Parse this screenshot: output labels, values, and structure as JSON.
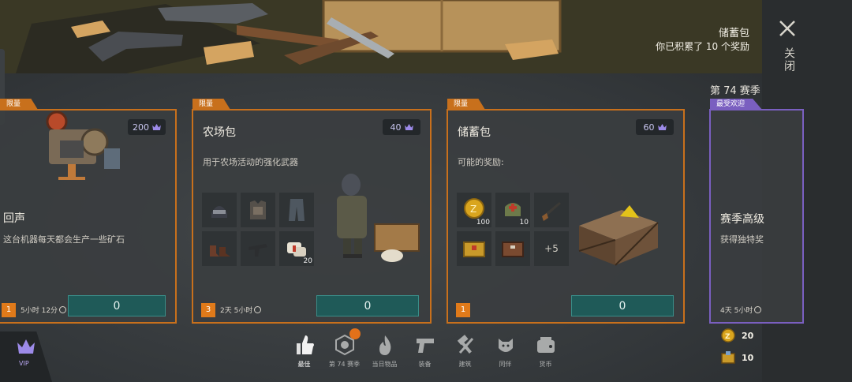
{
  "banner": {
    "title": "储蓄包",
    "subtitle": "你已积累了 10 个奖励"
  },
  "close_label": "关闭",
  "season_heading": "第 74 赛季",
  "cards": [
    {
      "tag": "限量",
      "title": "回声",
      "desc": "这台机器每天都会生产一些矿石",
      "price": "200",
      "qty": "1",
      "timer": "5小时 12分",
      "button": "0"
    },
    {
      "tag": "限量",
      "title": "农场包",
      "desc": "用于农场活动的强化武器",
      "price": "40",
      "qty": "3",
      "timer": "2天 5小时",
      "button": "0",
      "items": [
        {
          "icon": "helmet-icon",
          "count": ""
        },
        {
          "icon": "armor-vest-icon",
          "count": ""
        },
        {
          "icon": "pants-icon",
          "count": ""
        },
        {
          "icon": "boots-icon",
          "count": ""
        },
        {
          "icon": "smg-icon",
          "count": ""
        },
        {
          "icon": "bandage-icon",
          "count": "20"
        }
      ]
    },
    {
      "tag": "限量",
      "title": "储蓄包",
      "desc": "可能的奖励:",
      "price": "60",
      "qty": "1",
      "timer": "",
      "button": "0",
      "items": [
        {
          "icon": "coin-icon",
          "count": "100"
        },
        {
          "icon": "medkit-bag-icon",
          "count": "10"
        },
        {
          "icon": "shotgun-icon",
          "count": ""
        },
        {
          "icon": "yellow-crate-icon",
          "count": ""
        },
        {
          "icon": "brown-crate-icon",
          "count": ""
        }
      ],
      "more": "+5"
    },
    {
      "tag": "最受欢迎",
      "title": "赛季高级",
      "desc": "获得独特奖",
      "timer": "4天 5小时"
    }
  ],
  "nav": [
    {
      "label": "最佳",
      "icon": "thumbs-up-icon",
      "active": true
    },
    {
      "label": "第 74 赛季",
      "icon": "season-badge-icon"
    },
    {
      "label": "当日物品",
      "icon": "flame-icon"
    },
    {
      "label": "装备",
      "icon": "pistol-icon"
    },
    {
      "label": "建筑",
      "icon": "hammer-icon"
    },
    {
      "label": "同伴",
      "icon": "dog-icon"
    },
    {
      "label": "货币",
      "icon": "wallet-icon"
    }
  ],
  "vip_label": "VIP",
  "currency": {
    "coins": "20",
    "boxes": "10"
  },
  "colors": {
    "accent_orange": "#c8701c",
    "accent_purple": "#7a5fc0",
    "button_teal": "#1f5a58"
  }
}
